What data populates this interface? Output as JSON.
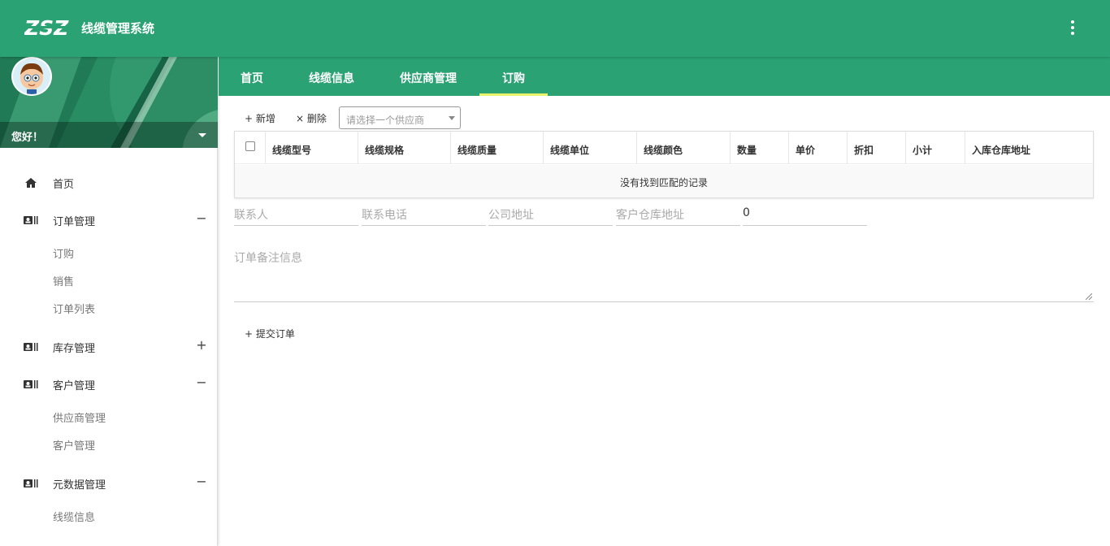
{
  "header": {
    "logo_text": "ZSZ",
    "app_title": "线缆管理系统",
    "menu_icon": "more-vertical-icon"
  },
  "colors": {
    "primary": "#2aa274",
    "tab_indicator": "#eaf26b",
    "profile_bg": "#1f7a55"
  },
  "profile": {
    "greeting": "您好！"
  },
  "sidebar": {
    "home": "首页",
    "order_mgmt": "订单管理",
    "order_mgmt_toggle": "−",
    "order_sub": [
      "订购",
      "销售",
      "订单列表"
    ],
    "stock_mgmt": "库存管理",
    "stock_mgmt_toggle": "+",
    "customer_mgmt": "客户管理",
    "customer_mgmt_toggle": "−",
    "customer_sub": [
      "供应商管理",
      "客户管理"
    ],
    "meta_mgmt": "元数据管理",
    "meta_mgmt_toggle": "−",
    "meta_sub": [
      "线缆信息"
    ]
  },
  "tabs": [
    {
      "label": "首页"
    },
    {
      "label": "线缆信息"
    },
    {
      "label": "供应商管理"
    },
    {
      "label": "订购",
      "active": true
    }
  ],
  "toolbar": {
    "add": "+ 新增",
    "delete": "× 删除",
    "supplier_placeholder": "请选择一个供应商"
  },
  "table": {
    "columns": [
      "线缆型号",
      "线缆规格",
      "线缆质量",
      "线缆单位",
      "线缆颜色",
      "数量",
      "单价",
      "折扣",
      "小计",
      "入库仓库地址"
    ],
    "empty_message": "没有找到匹配的记录"
  },
  "form": {
    "contact_placeholder": "联系人",
    "phone_placeholder": "联系电话",
    "company_address_placeholder": "公司地址",
    "warehouse_address_placeholder": "客户仓库地址",
    "total_value": "0",
    "remark_placeholder": "订单备注信息",
    "submit": "+ 提交订单"
  }
}
